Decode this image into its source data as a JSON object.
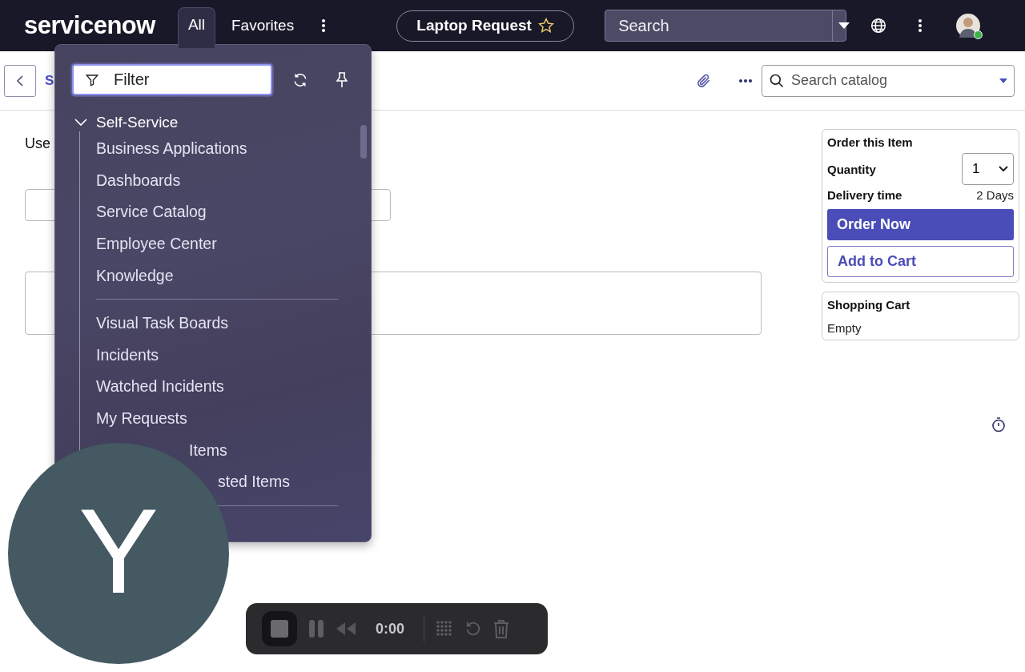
{
  "top_bar": {
    "logo": "servicenow",
    "nav_tabs": [
      {
        "label": "All",
        "selected": true
      },
      {
        "label": "Favorites",
        "selected": false
      }
    ],
    "record_title": "Laptop Request",
    "favorite": false,
    "search": {
      "placeholder": "Search"
    }
  },
  "sub_bar": {
    "breadcrumb": "S",
    "catalog_search": {
      "placeholder": "Search catalog"
    }
  },
  "content": {
    "intro": "Use"
  },
  "menu": {
    "filter": {
      "placeholder": "Filter"
    },
    "sections": [
      {
        "label": "Self-Service",
        "expanded": true,
        "groups": [
          {
            "items": [
              {
                "label": "Business Applications",
                "kind": "full"
              },
              {
                "label": "Dashboards",
                "kind": "full"
              },
              {
                "label": "Service Catalog",
                "kind": "full"
              },
              {
                "label": "Employee Center",
                "kind": "full"
              },
              {
                "label": "Knowledge",
                "kind": "full"
              }
            ]
          },
          {
            "items": [
              {
                "label": "Visual Task Boards",
                "kind": "full"
              },
              {
                "label": "Incidents",
                "kind": "full"
              },
              {
                "label": "Watched Incidents",
                "kind": "full"
              },
              {
                "label": "My Requests",
                "kind": "full"
              },
              {
                "label": "Items",
                "kind": "partial"
              },
              {
                "label": "sted Items",
                "kind": "partial"
              }
            ]
          }
        ]
      }
    ]
  },
  "order_card": {
    "title": "Order this Item",
    "quantity_label": "Quantity",
    "quantity": "1",
    "delivery_label": "Delivery time",
    "delivery_value": "2 Days",
    "primary_button": "Order Now",
    "secondary_button": "Add to Cart"
  },
  "cart": {
    "title": "Shopping Cart",
    "status": "Empty"
  },
  "video_bubble": {
    "initial": "Y"
  },
  "recorder": {
    "time": "0:00"
  }
}
